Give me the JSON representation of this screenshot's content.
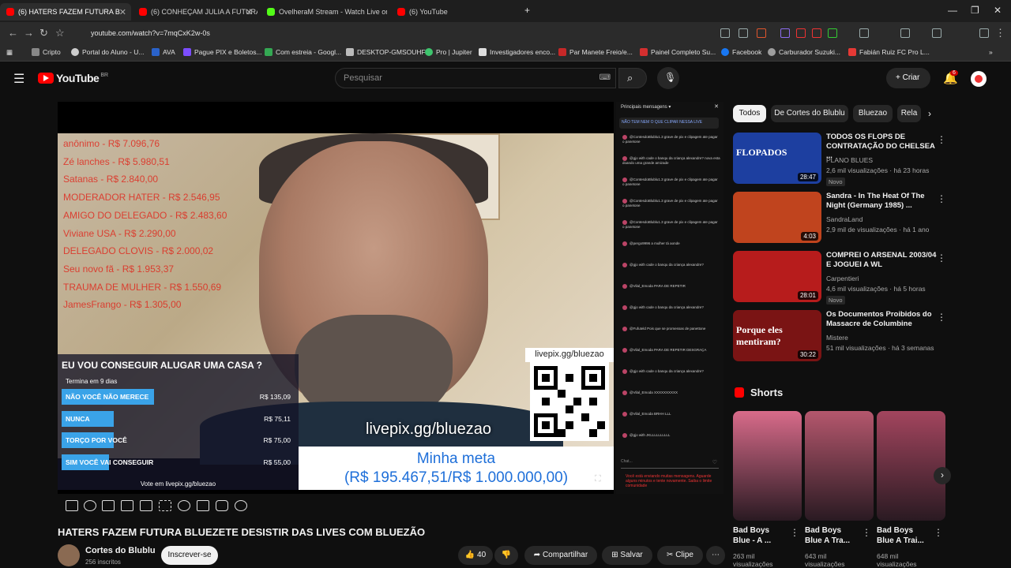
{
  "tabs": [
    {
      "label": "(6) HATERS FAZEM FUTURA B",
      "color": "#ff0000"
    },
    {
      "label": "(6) CONHEÇAM JULIA A FUTURA",
      "color": "#ff0000"
    },
    {
      "label": "OvelheraM Stream - Watch Live on K",
      "color": "#53fc18"
    },
    {
      "label": "(6) YouTube",
      "color": "#ff0000"
    }
  ],
  "address": {
    "url": "youtube.com/watch?v=7mqCxK2w-0s"
  },
  "bookmarks": [
    {
      "label": "Cripto",
      "color": "#888888"
    },
    {
      "label": "Portal do Aluno - U...",
      "color": "#cccccc"
    },
    {
      "label": "AVA",
      "color": "#2a62c9"
    },
    {
      "label": "Pague PIX e Boletos...",
      "color": "#7c4dff"
    },
    {
      "label": "Com estreia - Googl...",
      "color": "#34a853"
    },
    {
      "label": "DESKTOP-GMSOUHF",
      "color": "#bbbbbb"
    },
    {
      "label": "Pro | Jupiter",
      "color": "#3ec46d"
    },
    {
      "label": "Investigadores enco...",
      "color": "#dddddd"
    },
    {
      "label": "Par Manete Freio/e...",
      "color": "#c62828"
    },
    {
      "label": "Painel Completo Su...",
      "color": "#d32f2f"
    },
    {
      "label": "Facebook",
      "color": "#1877f2"
    },
    {
      "label": "Carburador Suzuki...",
      "color": "#9e9e9e"
    },
    {
      "label": "Fabián Ruiz FC Pro L...",
      "color": "#e53935"
    }
  ],
  "yt": {
    "logo": "YouTube",
    "country": "BR",
    "search_placeholder": "Pesquisar",
    "create_label": "Criar",
    "notif_count": "6"
  },
  "video": {
    "donations": [
      "anônimo - R$ 7.096,76",
      "Zé lanches - R$ 5.980,51",
      "Satanas - R$ 2.840,00",
      "MODERADOR HATER - R$ 2.546,95",
      "AMIGO DO DELEGADO - R$ 2.483,60",
      "Viviane USA - R$ 2.290,00",
      "DELEGADO CLOVIS - R$ 2.000,02",
      "Seu novo fã - R$ 1.953,37",
      "TRAUMA DE MULHER - R$ 1.550,69",
      "JamesFrango - R$ 1.305,00"
    ],
    "poll": {
      "question": "EU VOU CONSEGUIR ALUGAR UMA CASA ?",
      "ends": "Termina em 9 dias",
      "options": [
        {
          "label": "NÃO VOCÊ NÃO MERECE",
          "value": "R$ 135,09",
          "fraction": 0.39
        },
        {
          "label": "NUNCA",
          "value": "R$ 75,11",
          "fraction": 0.22
        },
        {
          "label": "TORÇO POR VOCÊ",
          "value": "R$ 75,00",
          "fraction": 0.22
        },
        {
          "label": "SIM VOCÊ VAI CONSEGUIR",
          "value": "R$ 55,00",
          "fraction": 0.16
        }
      ],
      "footer": "Vote em livepix.gg/bluezao"
    },
    "pix_url": "livepix.gg/bluezao",
    "pix_big": "livepix.gg/bluezao",
    "goal_label": "Minha meta",
    "goal_value": "(R$ 195.467,51/R$ 1.000.000,00)",
    "goal_progress": 0.195
  },
  "chat": {
    "header": "Principais mensagens",
    "pinned": "NÃO TEM NEM O QUE CLIPAR NESSA LIVE",
    "messages": [
      "@ContesdoBlublu1.3 grave de pix e clipagem ate pagar o panetone",
      "@gjo with cade o banqu da criança alexandre? nova esta doando uma grande amizade",
      "@ContesdoBlublu1.3 grave de pix e clipagem ate pagar o panetone",
      "@ContesdoBlublu1.3 grave de pix e clipagem ate pagar o panetone",
      "@ContesdoBlublu1.3 grave de pix e clipagem ate pagar o panetone",
      "@pergo9996 a mulher tá aonde",
      "@gjo with cade o banqu da criança alexandre?",
      "@Vilal_Emoda PARA DE REPETIR",
      "@gjo with cade o banqu da criança alexandre?",
      "@Fufuteld Pois que se promessas de panettone",
      "@Vilal_Emoda PARA DE REPETIR DESGRAÇA",
      "@gjo with cade o banqu da criança alexandre?",
      "@Vilal_Emoda XXXXXXXXXX",
      "@Vilal_Emoda BRHH LLL",
      "@gjo with JKLLLLLLLLLL"
    ],
    "input_placeholder": "Chat...",
    "warning": "Você está enviando muitas mensagens. Aguarde alguns minutos e tente novamente. Saiba o limite comunidade"
  },
  "meta": {
    "title": "HATERS FAZEM FUTURA BLUEZETE DESISTIR DAS LIVES COM BLUEZÃO",
    "channel": "Cortes do Blublu",
    "subs": "256 inscritos",
    "subscribe": "Inscrever-se",
    "likes": "40",
    "share": "Compartilhar",
    "save": "Salvar",
    "clip": "Clipe"
  },
  "chips": [
    "Todos",
    "De Cortes do Blublu",
    "Bluezao",
    "Rela"
  ],
  "recommended": [
    {
      "title": "TODOS OS FLOPS DE CONTRATAÇÃO DO CHELSEA ...",
      "channel": "PLANO BLUES",
      "meta": "2,6 mil visualizações · há 23 horas",
      "badge": "Novo",
      "duration": "28:47",
      "thumb_text": "FLOPADOS",
      "thumb_color": "#1d3fa0"
    },
    {
      "title": "Sandra - In The Heat Of The Night (Germany 1985) ...",
      "channel": "SandraLand",
      "meta": "2,9 mil de visualizações · há 1 ano",
      "badge": "",
      "duration": "4:03",
      "thumb_text": "",
      "thumb_color": "#c0441e"
    },
    {
      "title": "COMPREI O ARSENAL 2003/04 E JOGUEI A WL",
      "channel": "Carpentieri",
      "meta": "4,6 mil visualizações · há 5 horas",
      "badge": "Novo",
      "duration": "28:01",
      "thumb_text": "",
      "thumb_color": "#b71c1c"
    },
    {
      "title": "Os Documentos Proibidos do Massacre de Columbine",
      "channel": "Mistere",
      "meta": "51 mil visualizações · há 3 semanas",
      "badge": "",
      "duration": "30:22",
      "thumb_text": "Porque eles mentiram?",
      "thumb_color": "#7a1414"
    }
  ],
  "shorts": {
    "heading": "Shorts",
    "items": [
      {
        "title": "Bad Boys Blue - A ...",
        "views": "263 mil visualizações",
        "color": "#d86b8a"
      },
      {
        "title": "Bad Boys Blue A Tra...",
        "views": "643 mil visualizações",
        "color": "#b5576d"
      },
      {
        "title": "Bad Boys Blue A Trai...",
        "views": "648 mil visualizações",
        "color": "#a3455e"
      }
    ]
  }
}
